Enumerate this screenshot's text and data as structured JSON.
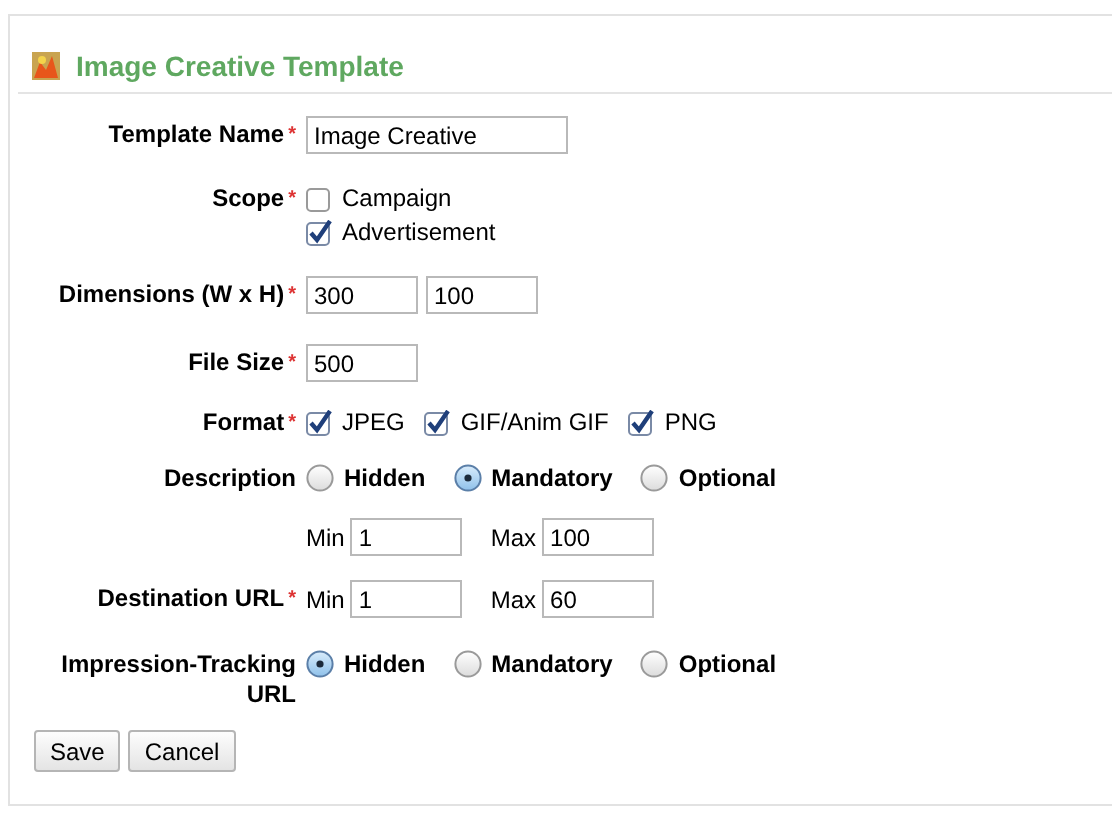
{
  "panel": {
    "title": "Image Creative Template"
  },
  "fields": [
    {
      "kind": "name",
      "label": "Template Name",
      "required_mark": "*",
      "value": "Image Creative"
    },
    {
      "kind": "checklist",
      "label": "Scope",
      "required_mark": "*",
      "options": [
        {
          "label": "Campaign",
          "checked": false
        },
        {
          "label": "Advertisement",
          "checked": true
        }
      ]
    },
    {
      "kind": "pair",
      "label": "Dimensions (W x H)",
      "required_mark": "*",
      "values": [
        "300",
        "100"
      ]
    },
    {
      "kind": "number",
      "label": "File Size",
      "required_mark": "*",
      "value": "500"
    },
    {
      "kind": "checkrow",
      "label": "Format",
      "required_mark": "*",
      "options": [
        {
          "label": "JPEG",
          "checked": true
        },
        {
          "label": "GIF/Anim GIF",
          "checked": true
        },
        {
          "label": "PNG",
          "checked": true
        }
      ]
    },
    {
      "kind": "radios",
      "label": "Description",
      "options": [
        {
          "label": "Hidden",
          "selected": false
        },
        {
          "label": "Mandatory",
          "selected": true
        },
        {
          "label": "Optional",
          "selected": false
        }
      ]
    },
    {
      "kind": "range",
      "min_label": "Min",
      "min_value": "1",
      "max_label": "Max",
      "max_value": "100"
    },
    {
      "kind": "range",
      "label": "Destination URL",
      "required_mark": "*",
      "min_label": "Min",
      "min_value": "1",
      "max_label": "Max",
      "max_value": "60"
    },
    {
      "kind": "radios",
      "label": "Impression-Tracking URL",
      "options": [
        {
          "label": "Hidden",
          "selected": true
        },
        {
          "label": "Mandatory",
          "selected": false
        },
        {
          "label": "Optional",
          "selected": false
        }
      ]
    }
  ],
  "buttons": [
    "Save",
    "Cancel"
  ]
}
